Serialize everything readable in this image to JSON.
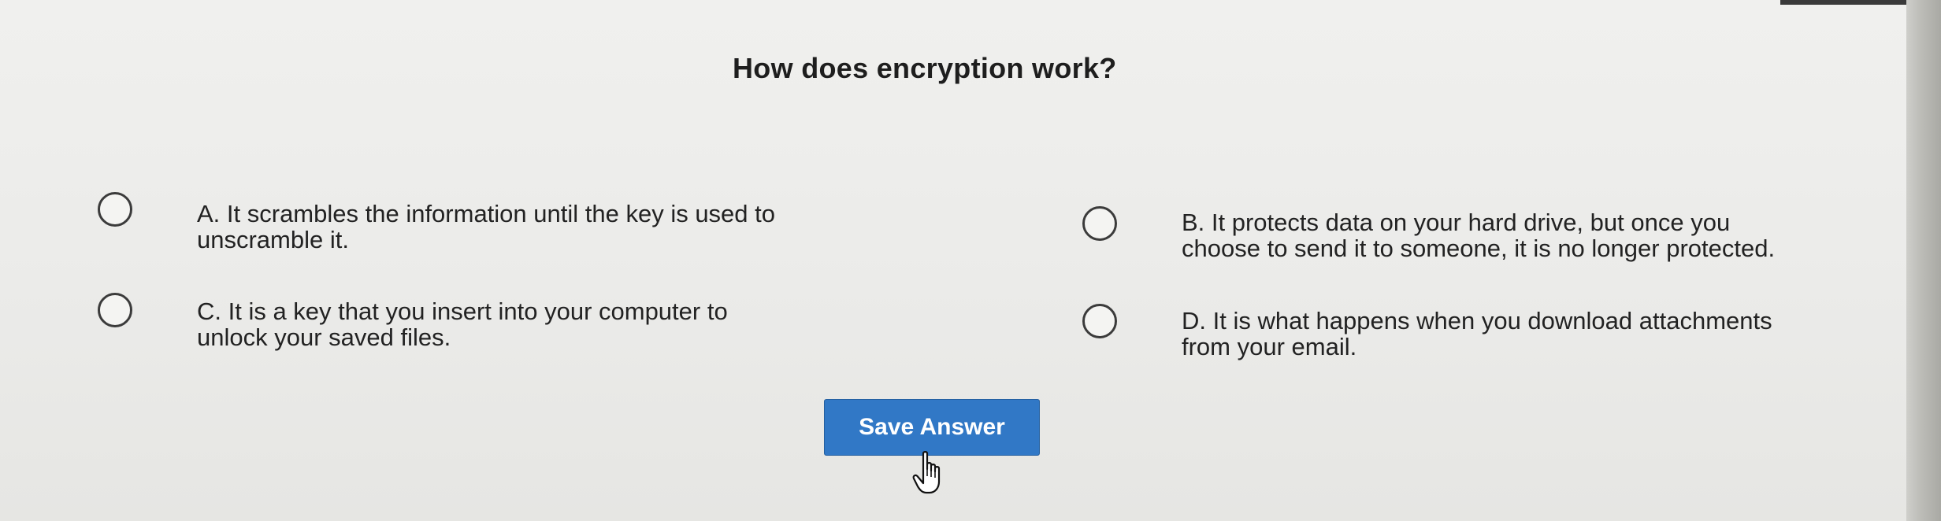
{
  "quiz": {
    "question": "How does encryption work?",
    "options": [
      {
        "letter": "A",
        "line1": "A. It scrambles the information until the key is used to",
        "line2": "unscramble it."
      },
      {
        "letter": "B",
        "line1": "B. It protects data on your hard drive, but once you",
        "line2": "choose to send it to someone, it is no longer protected."
      },
      {
        "letter": "C",
        "line1": "C. It is a key that you insert into your computer to",
        "line2": "unlock your saved files."
      },
      {
        "letter": "D",
        "line1": "D. It is what happens when you download attachments",
        "line2": "from your email."
      }
    ],
    "save_label": "Save Answer"
  },
  "theme": {
    "button_color": "#3178c6",
    "background": "#ebebe8",
    "text_color": "#1c1c1c"
  },
  "pointer": {
    "icon": "hand-pointer-icon"
  }
}
